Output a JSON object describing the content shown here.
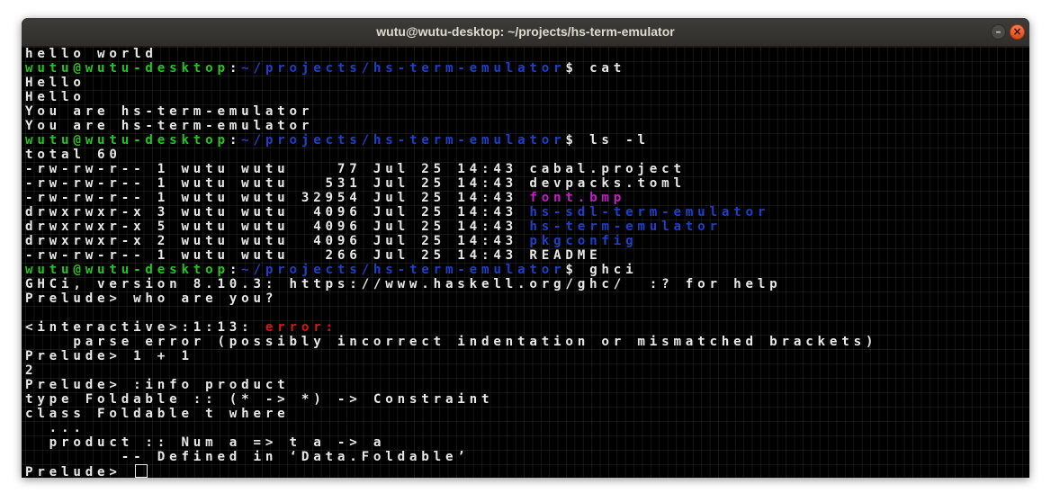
{
  "window": {
    "title": "wutu@wutu-desktop: ~/projects/hs-term-emulator",
    "min_glyph": "–",
    "close_glyph": "×"
  },
  "terminal": {
    "prompt_user": "wutu@wutu-desktop",
    "prompt_path": "~/projects/hs-term-emulator",
    "prompt_symbol": "$ ",
    "lines": [
      {
        "plain": "hello world"
      },
      {
        "prompt": true,
        "cmd": "cat"
      },
      {
        "plain": "Hello"
      },
      {
        "plain": "Hello"
      },
      {
        "plain": "You are hs-term-emulator"
      },
      {
        "plain": "You are hs-term-emulator"
      },
      {
        "prompt": true,
        "cmd": "ls -l"
      },
      {
        "plain": "total 60"
      },
      {
        "pre": "-rw-rw-r-- 1 wutu wutu    77 Jul 25 14:43 ",
        "name": "cabal.project",
        "color": "default"
      },
      {
        "pre": "-rw-rw-r-- 1 wutu wutu   531 Jul 25 14:43 ",
        "name": "devpacks.toml",
        "color": "default"
      },
      {
        "pre": "-rw-rw-r-- 1 wutu wutu 32954 Jul 25 14:43 ",
        "name": "font.bmp",
        "color": "magenta"
      },
      {
        "pre": "drwxrwxr-x 3 wutu wutu  4096 Jul 25 14:43 ",
        "name": "hs-sdl-term-emulator",
        "color": "blue"
      },
      {
        "pre": "drwxrwxr-x 5 wutu wutu  4096 Jul 25 14:43 ",
        "name": "hs-term-emulator",
        "color": "blue"
      },
      {
        "pre": "drwxrwxr-x 2 wutu wutu  4096 Jul 25 14:43 ",
        "name": "pkgconfig",
        "color": "blue"
      },
      {
        "pre": "-rw-rw-r-- 1 wutu wutu   266 Jul 25 14:43 ",
        "name": "README",
        "color": "default"
      },
      {
        "prompt": true,
        "cmd": "ghci"
      },
      {
        "plain": "GHCi, version 8.10.3: https://www.haskell.org/ghc/  :? for help"
      },
      {
        "plain": "Prelude> who are you?"
      },
      {
        "plain": ""
      },
      {
        "pre": "<interactive>:1:13: ",
        "name": "error:",
        "color": "red"
      },
      {
        "plain": "    parse error (possibly incorrect indentation or mismatched brackets)"
      },
      {
        "plain": "Prelude> 1 + 1"
      },
      {
        "plain": "2"
      },
      {
        "plain": "Prelude> :info product"
      },
      {
        "plain": "type Foldable :: (* -> *) -> Constraint"
      },
      {
        "plain": "class Foldable t where"
      },
      {
        "plain": "  ..."
      },
      {
        "plain": "  product :: Num a => t a -> a"
      },
      {
        "plain": "        -- Defined in ‘Data.Foldable’"
      },
      {
        "plain": "Prelude> ",
        "cursor": true
      }
    ]
  }
}
